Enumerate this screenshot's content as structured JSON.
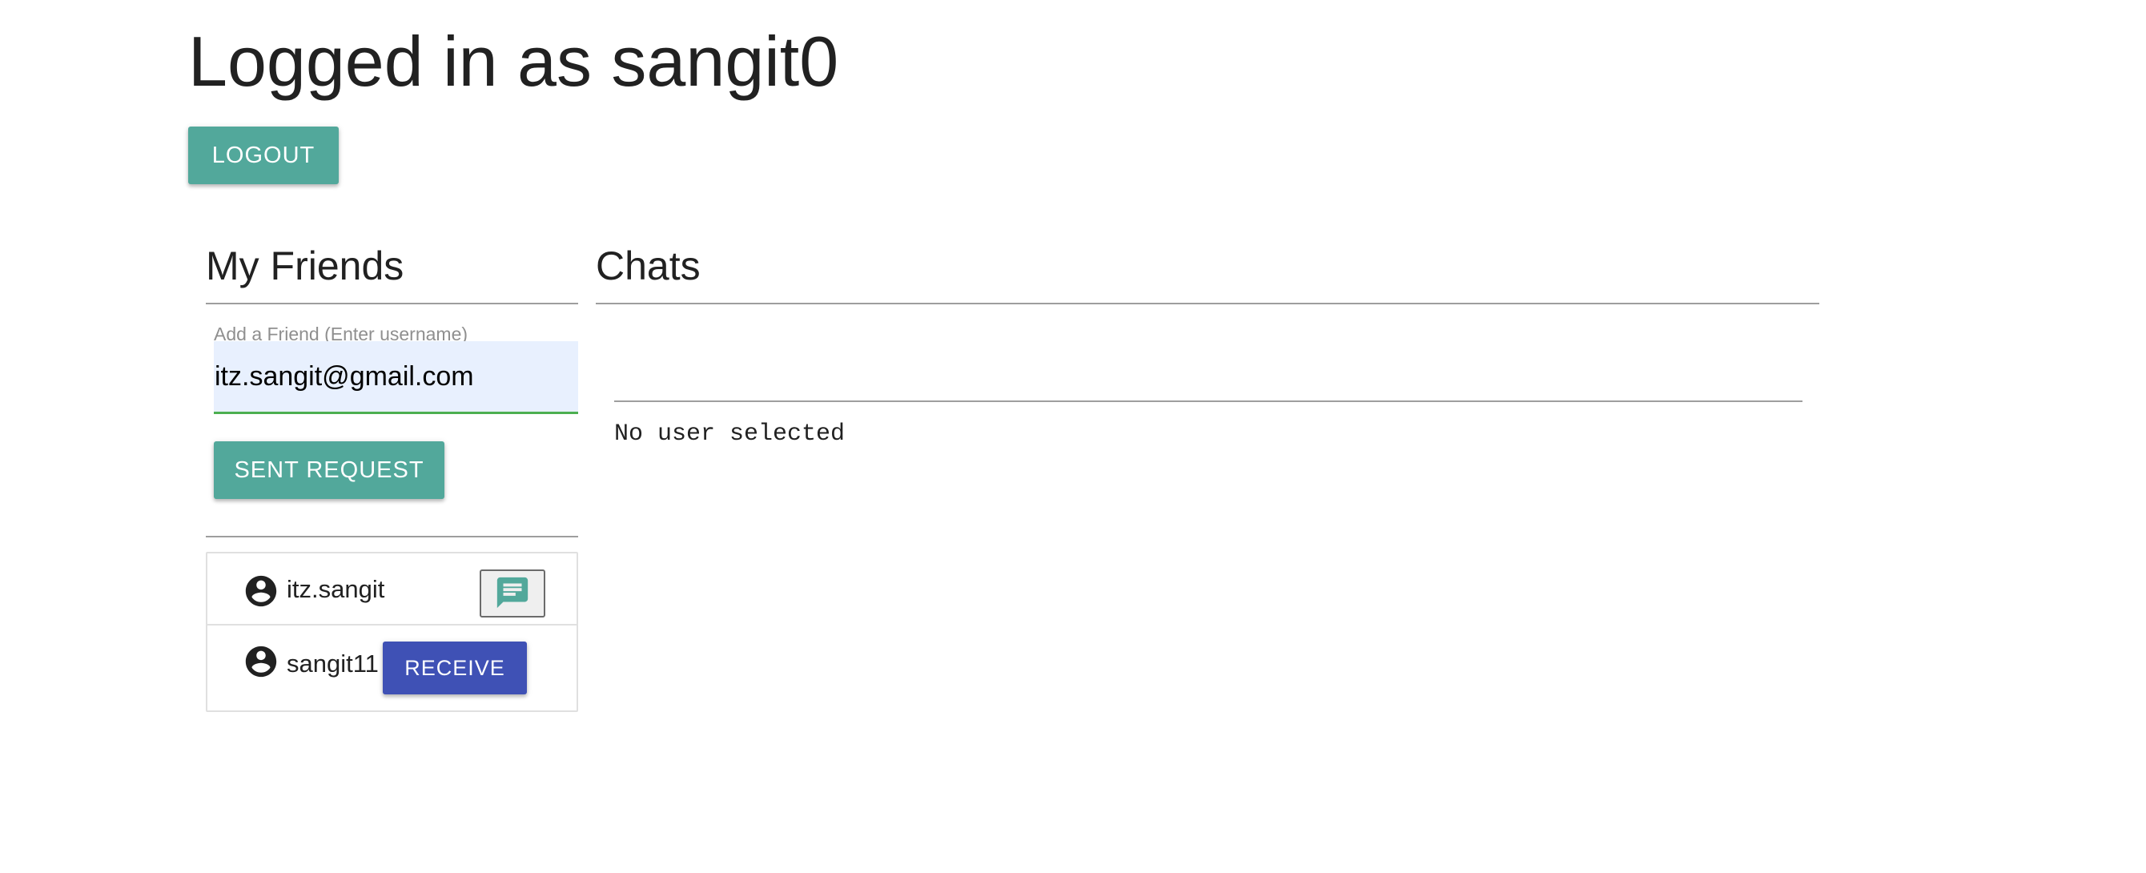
{
  "header": {
    "title": "Logged in as sangit0",
    "logout_label": "LOGOUT"
  },
  "friends": {
    "title": "My Friends",
    "add_label": "Add a Friend (Enter username)",
    "input_value": "itz.sangit@gmail.com",
    "send_label": "SENT REQUEST",
    "items": [
      {
        "name": "itz.sangit",
        "action": "chat-icon"
      },
      {
        "name": "sangit11",
        "action_label": "RECEIVE"
      }
    ]
  },
  "chats": {
    "title": "Chats",
    "empty_text": "No user selected"
  },
  "colors": {
    "primary": "#52a89b",
    "accent": "#3f51b5",
    "input_focus": "#4caf50",
    "input_bg": "#e8f0fe"
  }
}
